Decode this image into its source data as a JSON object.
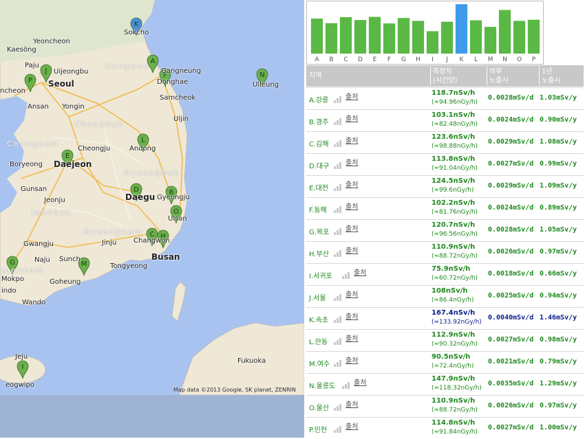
{
  "map": {
    "cities": [
      {
        "id": "sokcho",
        "name": "Sokcho"
      },
      {
        "id": "yeoncheon",
        "name": "Yeoncheon"
      },
      {
        "id": "kaesong",
        "name": "Kaesŏng"
      },
      {
        "id": "paju",
        "name": "Paju"
      },
      {
        "id": "uijeongbu",
        "name": "Uijeongbu"
      },
      {
        "id": "seoul",
        "name": "Seoul"
      },
      {
        "id": "incheon",
        "name": "ncheon"
      },
      {
        "id": "ansan",
        "name": "Ansan"
      },
      {
        "id": "yongin",
        "name": "Yongin"
      },
      {
        "id": "gangneung",
        "name": "Gangneung"
      },
      {
        "id": "donghae",
        "name": "Donghae"
      },
      {
        "id": "samcheok",
        "name": "Samcheok"
      },
      {
        "id": "ulleung",
        "name": "Ulleung"
      },
      {
        "id": "uljin",
        "name": "Uljin"
      },
      {
        "id": "cheongju",
        "name": "Cheongju"
      },
      {
        "id": "andong",
        "name": "Andong"
      },
      {
        "id": "boryeong",
        "name": "Boryeong"
      },
      {
        "id": "daejeon",
        "name": "Daejeon"
      },
      {
        "id": "gunsan",
        "name": "Gunsan"
      },
      {
        "id": "jeonju",
        "name": "Jeonju"
      },
      {
        "id": "daegu",
        "name": "Daegu"
      },
      {
        "id": "gyeongju",
        "name": "Gyeongju"
      },
      {
        "id": "ulsan",
        "name": "Ulsan"
      },
      {
        "id": "gwangju",
        "name": "Gwangju"
      },
      {
        "id": "jinju",
        "name": "Jinju"
      },
      {
        "id": "changwon",
        "name": "Changwon"
      },
      {
        "id": "busan",
        "name": "Busan"
      },
      {
        "id": "naju",
        "name": "Naju"
      },
      {
        "id": "suncheon",
        "name": "Sunch"
      },
      {
        "id": "tongyeong",
        "name": "Tongyeong"
      },
      {
        "id": "mokpo",
        "name": "Mokpo"
      },
      {
        "id": "goheung",
        "name": "Goheung"
      },
      {
        "id": "wando",
        "name": "Wando"
      },
      {
        "id": "jeju",
        "name": "Jeju"
      },
      {
        "id": "seogwipo",
        "name": "eogwipo"
      },
      {
        "id": "fukuoka",
        "name": "Fukuoka"
      },
      {
        "id": "indo",
        "name": "indo"
      }
    ],
    "regions": [
      {
        "id": "gangwon",
        "name": "Gangwon"
      },
      {
        "id": "chungbuk",
        "name": "Chungbuk"
      },
      {
        "id": "chungnam",
        "name": "Chungnam"
      },
      {
        "id": "gyeongbuk",
        "name": "Gyeongbuk"
      },
      {
        "id": "jeonbuk",
        "name": "Jeonbuk"
      },
      {
        "id": "gyeongnam",
        "name": "Gyeongnam"
      },
      {
        "id": "jeonnam",
        "name": "Jeonnam"
      }
    ],
    "markers": [
      {
        "letter": "K",
        "color": "#4a90d9"
      },
      {
        "letter": "A",
        "color": "#6ab04c"
      },
      {
        "letter": "F",
        "color": "#6ab04c"
      },
      {
        "letter": "N",
        "color": "#6ab04c"
      },
      {
        "letter": "J",
        "color": "#6ab04c"
      },
      {
        "letter": "P",
        "color": "#6ab04c"
      },
      {
        "letter": "L",
        "color": "#6ab04c"
      },
      {
        "letter": "E",
        "color": "#6ab04c"
      },
      {
        "letter": "D",
        "color": "#6ab04c"
      },
      {
        "letter": "B",
        "color": "#6ab04c"
      },
      {
        "letter": "O",
        "color": "#6ab04c"
      },
      {
        "letter": "C",
        "color": "#6ab04c"
      },
      {
        "letter": "H",
        "color": "#6ab04c"
      },
      {
        "letter": "G",
        "color": "#6ab04c"
      },
      {
        "letter": "M",
        "color": "#6ab04c"
      },
      {
        "letter": "I",
        "color": "#6ab04c"
      }
    ],
    "attribution": "Map data ©2013 Google, SK planet, ZENRIN"
  },
  "chart_data": {
    "type": "bar",
    "categories": [
      "A",
      "B",
      "C",
      "D",
      "E",
      "F",
      "G",
      "H",
      "I",
      "J",
      "K",
      "L",
      "M",
      "N",
      "O",
      "P"
    ],
    "values": [
      118.7,
      103.1,
      123.6,
      113.8,
      124.5,
      102.2,
      120.7,
      110.9,
      75.9,
      108,
      167.4,
      112.9,
      90.5,
      147.9,
      110.9,
      114.8
    ],
    "highlight": "K",
    "colors": {
      "bar": "#5ab845",
      "highlight": "#3d9be9"
    },
    "ylim": [
      0,
      170
    ],
    "grid": false
  },
  "table": {
    "headers": {
      "region": "지역",
      "measure": "측정치",
      "measure_sub": "(시간당)",
      "day": "하루",
      "day_sub": "노출시",
      "year": "1년",
      "year_sub": "노출시"
    },
    "source_label": "출처",
    "rows": [
      {
        "name": "A.강릉",
        "nsv": "118.7nSv/h",
        "ngy": "(≈94.96nGy/h)",
        "day": "0.0028mSv/d",
        "year": "1.03mSv/y"
      },
      {
        "name": "B.경주",
        "nsv": "103.1nSv/h",
        "ngy": "(≈82.48nGy/h)",
        "day": "0.0024mSv/d",
        "year": "0.90mSv/y"
      },
      {
        "name": "C.김해",
        "nsv": "123.6nSv/h",
        "ngy": "(≈98.88nGy/h)",
        "day": "0.0029mSv/d",
        "year": "1.08mSv/y"
      },
      {
        "name": "D.대구",
        "nsv": "113.8nSv/h",
        "ngy": "(≈91.04nGy/h)",
        "day": "0.0027mSv/d",
        "year": "0.99mSv/y"
      },
      {
        "name": "E.대전",
        "nsv": "124.5nSv/h",
        "ngy": "(≈99.6nGy/h)",
        "day": "0.0029mSv/d",
        "year": "1.09mSv/y"
      },
      {
        "name": "F.동해",
        "nsv": "102.2nSv/h",
        "ngy": "(≈81.76nGy/h)",
        "day": "0.0024mSv/d",
        "year": "0.89mSv/y"
      },
      {
        "name": "G.목포",
        "nsv": "120.7nSv/h",
        "ngy": "(≈96.56nGy/h)",
        "day": "0.0028mSv/d",
        "year": "1.05mSv/y"
      },
      {
        "name": "H.부산",
        "nsv": "110.9nSv/h",
        "ngy": "(≈88.72nGy/h)",
        "day": "0.0026mSv/d",
        "year": "0.97mSv/y"
      },
      {
        "name": "I.서귀포",
        "nsv": "75.9nSv/h",
        "ngy": "(≈60.72nGy/h)",
        "day": "0.0018mSv/d",
        "year": "0.66mSv/y"
      },
      {
        "name": "J.서울",
        "nsv": "108nSv/h",
        "ngy": "(≈86.4nGy/h)",
        "day": "0.0025mSv/d",
        "year": "0.94mSv/y"
      },
      {
        "name": "K.속초",
        "nsv": "167.4nSv/h",
        "ngy": "(≈133.92nGy/h)",
        "day": "0.0040mSv/d",
        "year": "1.46mSv/y",
        "highlight": true
      },
      {
        "name": "L.안동",
        "nsv": "112.9nSv/h",
        "ngy": "(≈90.32nGy/h)",
        "day": "0.0027mSv/d",
        "year": "0.98mSv/y"
      },
      {
        "name": "M.여수",
        "nsv": "90.5nSv/h",
        "ngy": "(≈72.4nGy/h)",
        "day": "0.0021mSv/d",
        "year": "0.79mSv/y"
      },
      {
        "name": "N.울릉도",
        "nsv": "147.9nSv/h",
        "ngy": "(≈118.32nGy/h)",
        "day": "0.0035mSv/d",
        "year": "1.29mSv/y"
      },
      {
        "name": "O.울산",
        "nsv": "110.9nSv/h",
        "ngy": "(≈88.72nGy/h)",
        "day": "0.0026mSv/d",
        "year": "0.97mSv/y"
      },
      {
        "name": "P.인천",
        "nsv": "114.8nSv/h",
        "ngy": "(≈91.84nGy/h)",
        "day": "0.0027mSv/d",
        "year": "1.00mSv/y"
      }
    ]
  }
}
